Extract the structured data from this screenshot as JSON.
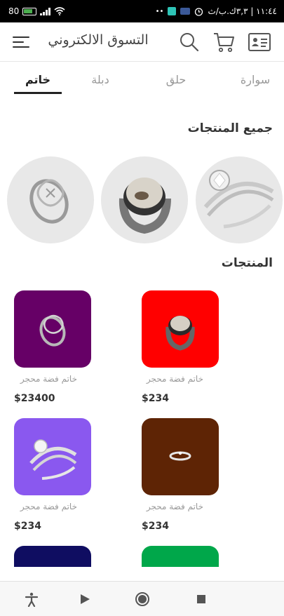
{
  "status_bar": {
    "time": "١١:٤٤ | ٣,٣ك.ب/ث",
    "battery": "80"
  },
  "header": {
    "title": "التسوق الالكتروني"
  },
  "tabs": [
    {
      "label": "سوارة",
      "active": false
    },
    {
      "label": "حلق",
      "active": false
    },
    {
      "label": "دبلة",
      "active": false
    },
    {
      "label": "خاتم",
      "active": true
    }
  ],
  "sections": {
    "all_products": "جميع المنتجات",
    "products": "المنتجات"
  },
  "products": [
    {
      "name": "خاتم فضة محجر",
      "price": "$234",
      "color": "#ff0000"
    },
    {
      "name": "خاتم فضة محجر",
      "price": "$23400",
      "color": "#660066"
    },
    {
      "name": "خاتم فضة محجر",
      "price": "$234",
      "color": "#5e2405"
    },
    {
      "name": "خاتم فضة محجر",
      "price": "$234",
      "color": "#8a58ef"
    },
    {
      "color": "#00a74a"
    },
    {
      "color": "#0f0d61"
    }
  ]
}
